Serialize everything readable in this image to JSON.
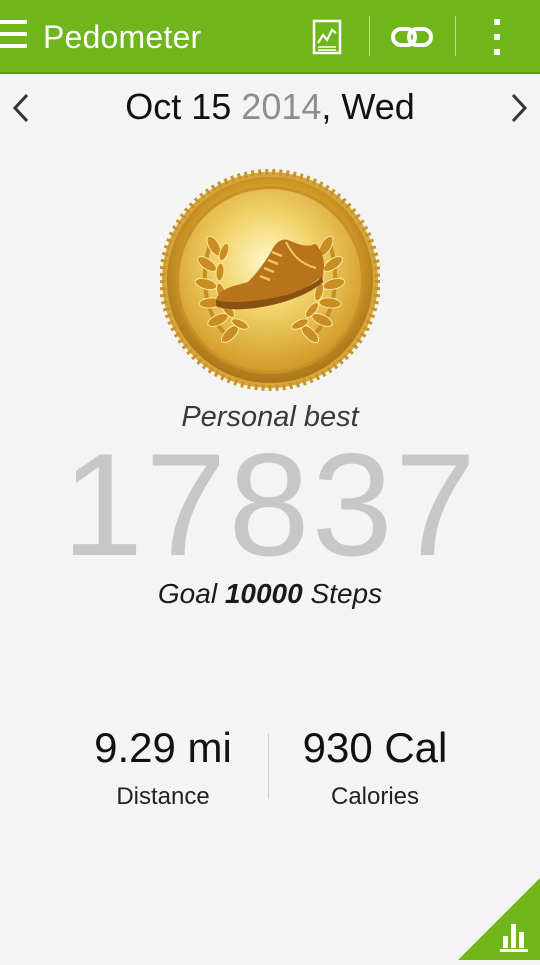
{
  "app_bar": {
    "title": "Pedometer",
    "background_color": "#6fb51c",
    "actions": [
      "chart-icon",
      "link-icon",
      "overflow-menu-icon"
    ]
  },
  "date_nav": {
    "month_day": "Oct 15",
    "year": "2014",
    "weekday": ", Wed",
    "prev_icon": "chevron-left-icon",
    "next_icon": "chevron-right-icon"
  },
  "achievement": {
    "badge_icon": "gold-medal-shoe-icon",
    "label": "Personal best"
  },
  "steps": {
    "count": "17837",
    "goal_prefix": "Goal ",
    "goal_value": "10000",
    "goal_suffix": " Steps"
  },
  "stats": {
    "distance_value": "9.29 mi",
    "distance_label": "Distance",
    "calories_value": "930 Cal",
    "calories_label": "Calories"
  },
  "corner_button": {
    "icon": "bar-chart-icon",
    "color": "#6fb51c"
  }
}
